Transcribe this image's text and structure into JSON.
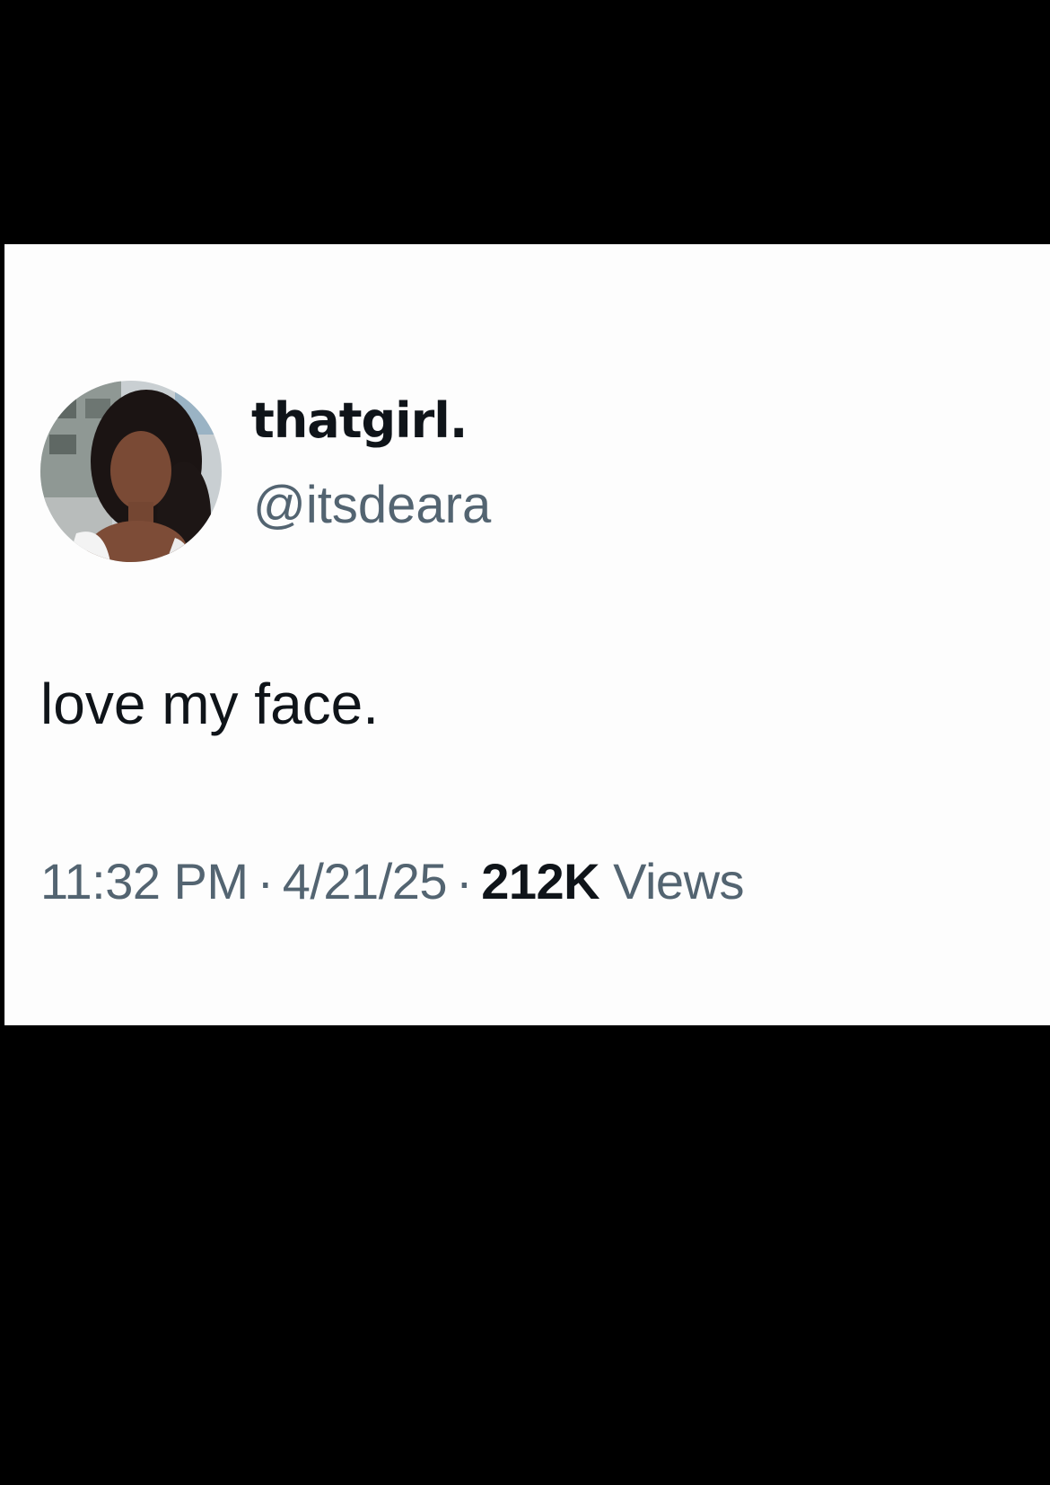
{
  "tweet": {
    "author": {
      "display_name": "thatgirl.",
      "handle": "@itsdeara",
      "avatar": "profile-photo"
    },
    "text": "love my face.",
    "time": "11:32 PM",
    "separator": "·",
    "date": "4/21/25",
    "views_count": "212K",
    "views_label": "Views"
  },
  "colors": {
    "background": "#000000",
    "card": "#fdfdfd",
    "primary_text": "#0f1419",
    "secondary_text": "#536471"
  }
}
